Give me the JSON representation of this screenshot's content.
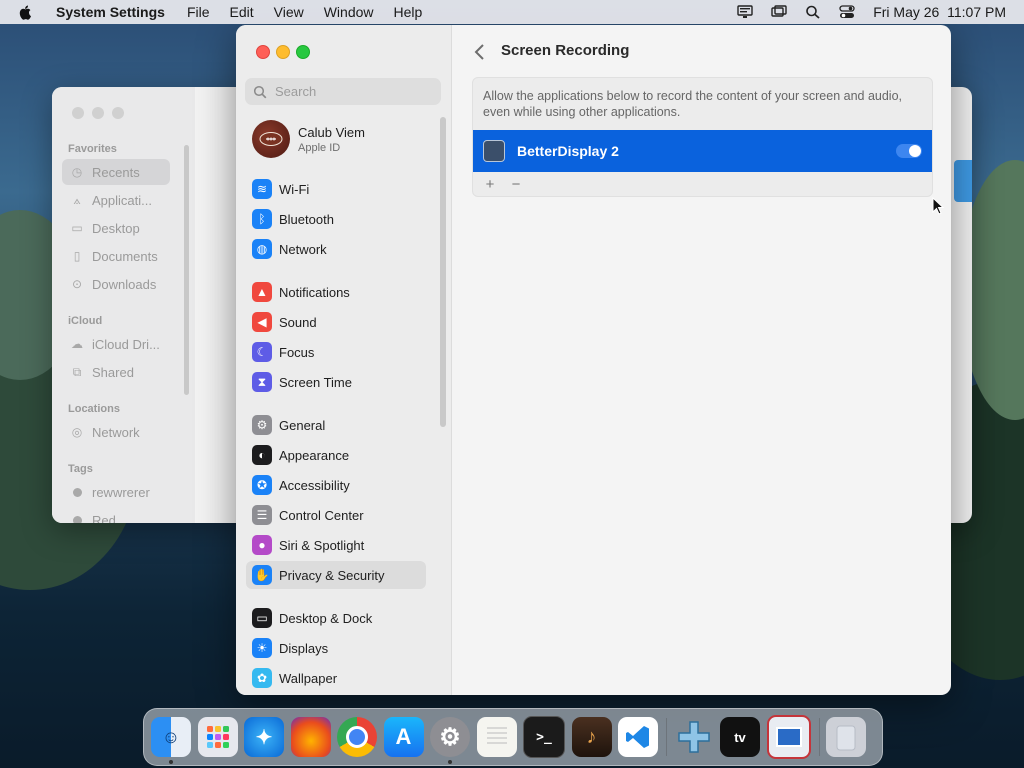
{
  "menubar": {
    "app_name": "System Settings",
    "menus": [
      "File",
      "Edit",
      "View",
      "Window",
      "Help"
    ],
    "datetime": "Fri May 26  11:07 PM"
  },
  "finder": {
    "sections": [
      "Favorites",
      "iCloud",
      "Locations",
      "Tags"
    ],
    "favorites": [
      "Recents",
      "Applicati...",
      "Desktop",
      "Documents",
      "Downloads"
    ],
    "icloud": [
      "iCloud Dri...",
      "Shared"
    ],
    "locations": [
      "Network"
    ],
    "tags": [
      "rewwrerer",
      "Red"
    ]
  },
  "settings": {
    "search_placeholder": "Search",
    "profile": {
      "name": "Calub Viem",
      "subtitle": "Apple ID"
    },
    "sidebar_items": [
      {
        "label": "Wi-Fi",
        "color": "#1a82f7",
        "icon": "wifi-icon"
      },
      {
        "label": "Bluetooth",
        "color": "#1a82f7",
        "icon": "bluetooth-icon"
      },
      {
        "label": "Network",
        "color": "#1a82f7",
        "icon": "globe-icon"
      },
      {
        "label": "Notifications",
        "color": "#f0483e",
        "icon": "bell-icon"
      },
      {
        "label": "Sound",
        "color": "#f0483e",
        "icon": "speaker-icon"
      },
      {
        "label": "Focus",
        "color": "#5e5ce6",
        "icon": "moon-icon"
      },
      {
        "label": "Screen Time",
        "color": "#5e5ce6",
        "icon": "hourglass-icon"
      },
      {
        "label": "General",
        "color": "#8e8e93",
        "icon": "gear-icon"
      },
      {
        "label": "Appearance",
        "color": "#1c1c1e",
        "icon": "appearance-icon"
      },
      {
        "label": "Accessibility",
        "color": "#1a82f7",
        "icon": "accessibility-icon"
      },
      {
        "label": "Control Center",
        "color": "#8e8e93",
        "icon": "toggles-icon"
      },
      {
        "label": "Siri & Spotlight",
        "color": "#b44ac8",
        "icon": "siri-icon"
      },
      {
        "label": "Privacy & Security",
        "color": "#1a82f7",
        "icon": "hand-icon"
      },
      {
        "label": "Desktop & Dock",
        "color": "#1c1c1e",
        "icon": "dock-icon"
      },
      {
        "label": "Displays",
        "color": "#1a82f7",
        "icon": "sun-icon"
      },
      {
        "label": "Wallpaper",
        "color": "#35b9f0",
        "icon": "flower-icon"
      }
    ],
    "page_title": "Screen Recording",
    "description": "Allow the applications below to record the content of your screen and audio, even while using other applications.",
    "apps": [
      {
        "name": "BetterDisplay 2",
        "enabled": true
      }
    ],
    "add_label": "+",
    "remove_label": "−"
  },
  "dock": [
    "Finder",
    "Launchpad",
    "Safari",
    "Firefox",
    "Chrome",
    "App Store",
    "System Settings",
    "TextEdit",
    "Terminal",
    "GarageBand",
    "VS Code",
    "PPSSPP",
    "Apple TV",
    "BetterDisplay",
    "Trash"
  ]
}
